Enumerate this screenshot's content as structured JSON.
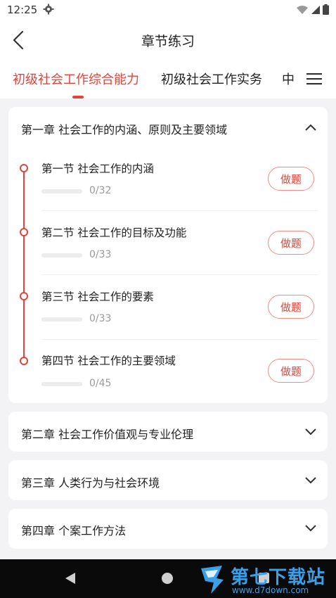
{
  "status": {
    "time": "12:25"
  },
  "header": {
    "title": "章节练习"
  },
  "tabs": [
    {
      "label": "初级社会工作综合能力",
      "active": true
    },
    {
      "label": "初级社会工作实务",
      "active": false
    },
    {
      "label": "中",
      "active": false
    }
  ],
  "chapters": [
    {
      "title": "第一章 社会工作的内涵、原则及主要领域",
      "expanded": true,
      "sections": [
        {
          "name": "第一节 社会工作的内涵",
          "progress": "0/32",
          "done": 0,
          "total": 32,
          "button": "做题"
        },
        {
          "name": "第二节 社会工作的目标及功能",
          "progress": "0/33",
          "done": 0,
          "total": 33,
          "button": "做题"
        },
        {
          "name": "第三节 社会工作的要素",
          "progress": "0/33",
          "done": 0,
          "total": 33,
          "button": "做题"
        },
        {
          "name": "第四节 社会工作的主要领域",
          "progress": "0/45",
          "done": 0,
          "total": 45,
          "button": "做题"
        }
      ]
    },
    {
      "title": "第二章 社会工作价值观与专业伦理",
      "expanded": false
    },
    {
      "title": "第三章 人类行为与社会环境",
      "expanded": false
    },
    {
      "title": "第四章 个案工作方法",
      "expanded": false
    }
  ],
  "watermark": {
    "name": "第七下载站",
    "url": "www.d7down.com"
  },
  "colors": {
    "accent": "#e0453a",
    "background": "#f3f3f5",
    "nav": "#0a0a0a"
  }
}
